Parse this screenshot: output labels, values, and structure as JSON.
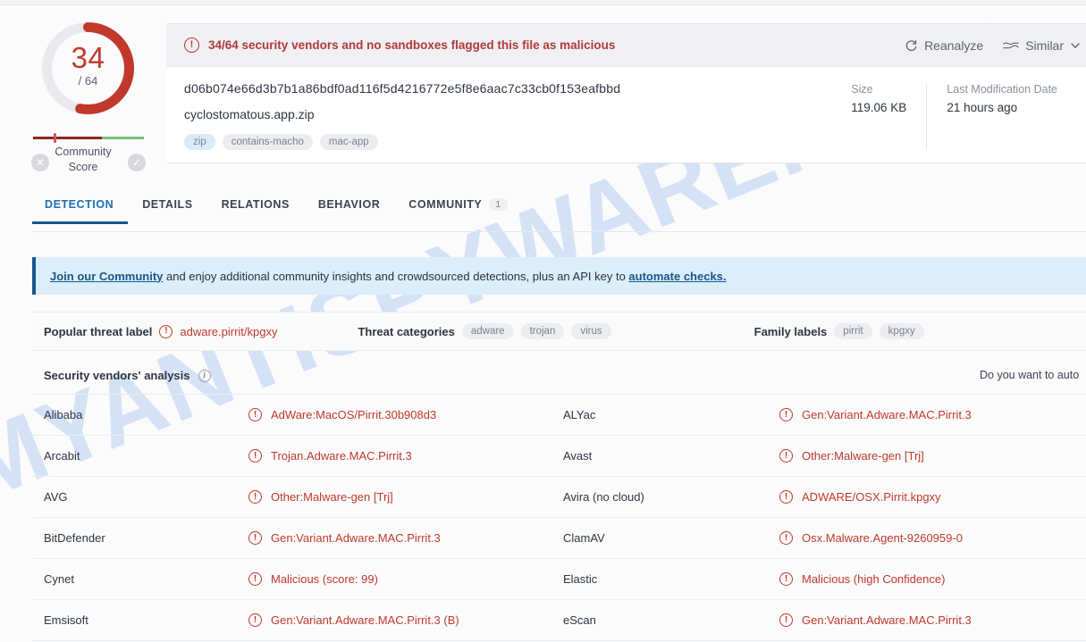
{
  "summary": {
    "score": "34",
    "denominator": "/ 64",
    "community_score_label": "Community\nScore",
    "community_line1": "Community",
    "community_line2": "Score",
    "negative_icon": "thumbs-down-circle-icon",
    "positive_icon": "check-circle-icon",
    "gauge_percent": 53,
    "gauge_color": "#c0392b",
    "gauge_track_color": "#e9eaee"
  },
  "file_card": {
    "alert_icon": "exclamation-circle-icon",
    "alert_text": "34/64 security vendors and no sandboxes flagged this file as malicious",
    "alert_color": "#b03a3a",
    "reanalyze_label": "Reanalyze",
    "reanalyze_icon": "refresh-icon",
    "similar_label": "Similar",
    "similar_icon": "similar-waves-icon",
    "similar_chevron": "chevron-down-icon",
    "hash": "d06b074e66d3b7b1a86bdf0ad116f5d4216772e5f8e6aac7c33cb0f153eafbbd",
    "filename": "cyclostomatous.app.zip",
    "tags": [
      {
        "label": "zip",
        "style": "blue"
      },
      {
        "label": "contains-macho",
        "style": "grey"
      },
      {
        "label": "mac-app",
        "style": "grey"
      }
    ],
    "meta": [
      {
        "label": "Size",
        "value": "119.06 KB"
      },
      {
        "label": "Last Modification Date",
        "value": "21 hours ago"
      }
    ]
  },
  "tabs": [
    {
      "label": "DETECTION",
      "active": true,
      "badge": ""
    },
    {
      "label": "DETAILS",
      "active": false,
      "badge": ""
    },
    {
      "label": "RELATIONS",
      "active": false,
      "badge": ""
    },
    {
      "label": "BEHAVIOR",
      "active": false,
      "badge": ""
    },
    {
      "label": "COMMUNITY",
      "active": false,
      "badge": "1"
    }
  ],
  "community_banner": {
    "link1": "Join our Community",
    "mid": " and enjoy additional community insights and crowdsourced detections, plus an API key to ",
    "link2": "automate checks.",
    "accent": "#17578c",
    "background": "#ddeefb"
  },
  "threat_row": {
    "popular_label": "Popular threat label",
    "popular_icon": "exclamation-circle-icon",
    "popular_value": "adware.pirrit/kpgxy",
    "categories_label": "Threat categories",
    "categories": [
      "adware",
      "trojan",
      "virus"
    ],
    "family_label": "Family labels",
    "families": [
      "pirrit",
      "kpgxy"
    ]
  },
  "vendors_header": {
    "title": "Security vendors' analysis",
    "info_icon": "info-circle-icon",
    "auto_text": "Do you want to auto"
  },
  "vendor_table": {
    "rows": [
      {
        "left_vendor": "Alibaba",
        "left_result": "AdWare:MacOS/Pirrit.30b908d3",
        "right_vendor": "ALYac",
        "right_result": "Gen:Variant.Adware.MAC.Pirrit.3"
      },
      {
        "left_vendor": "Arcabit",
        "left_result": "Trojan.Adware.MAC.Pirrit.3",
        "right_vendor": "Avast",
        "right_result": "Other:Malware-gen [Trj]"
      },
      {
        "left_vendor": "AVG",
        "left_result": "Other:Malware-gen [Trj]",
        "right_vendor": "Avira (no cloud)",
        "right_result": "ADWARE/OSX.Pirrit.kpgxy"
      },
      {
        "left_vendor": "BitDefender",
        "left_result": "Gen:Variant.Adware.MAC.Pirrit.3",
        "right_vendor": "ClamAV",
        "right_result": "Osx.Malware.Agent-9260959-0"
      },
      {
        "left_vendor": "Cynet",
        "left_result": "Malicious (score: 99)",
        "right_vendor": "Elastic",
        "right_result": "Malicious (high Confidence)"
      },
      {
        "left_vendor": "Emsisoft",
        "left_result": "Gen:Variant.Adware.MAC.Pirrit.3 (B)",
        "right_vendor": "eScan",
        "right_result": "Gen:Variant.Adware.MAC.Pirrit.3"
      }
    ]
  },
  "watermark": {
    "text": "MYANTISPYWARE.COM",
    "color": "#cbdcf5"
  }
}
